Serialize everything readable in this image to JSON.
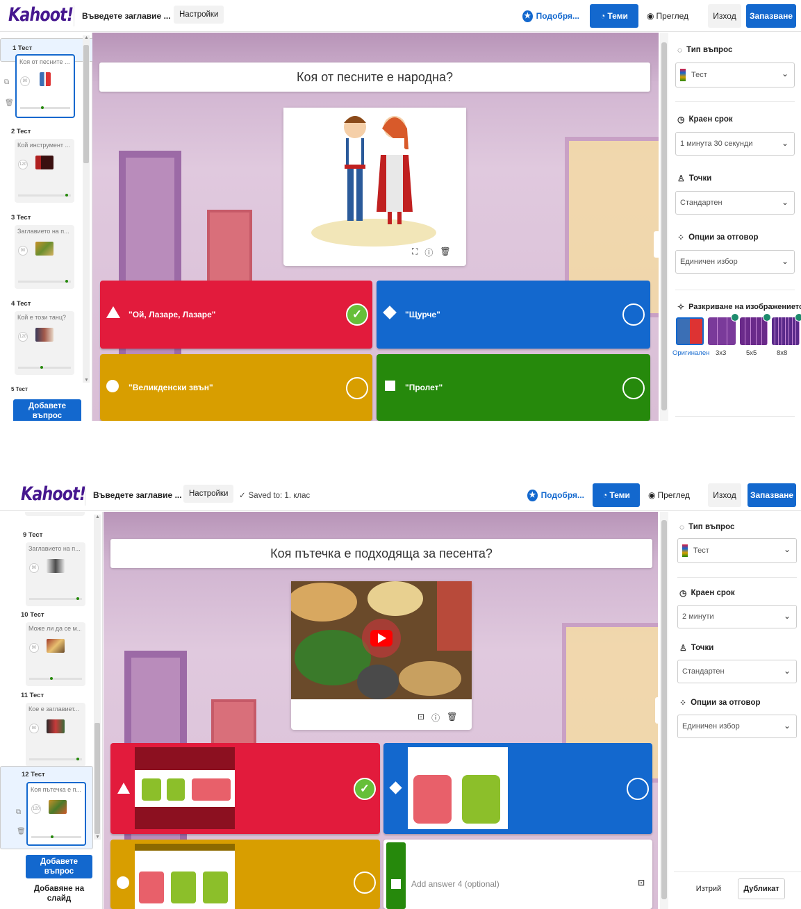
{
  "brand": {
    "logo": "Kahoot!"
  },
  "header": {
    "title_placeholder": "Въведете заглавие ...",
    "settings": "Настройки",
    "upgrade": "Подобря...",
    "themes": "Теми",
    "preview": "Преглед",
    "exit": "Изход",
    "save": "Запазване",
    "saved_status": "Saved to: 1. клас"
  },
  "sidebar": {
    "add_question": "Добавете въпрос",
    "add_slide": "Добавяне на слайд",
    "top_slides": [
      {
        "label": "1 Тест",
        "question": "Коя от песните ...",
        "time": "90"
      },
      {
        "label": "2 Тест",
        "question": "Кой инструмент ...",
        "time": "120"
      },
      {
        "label": "3 Тест",
        "question": "Заглавието на п...",
        "time": "90"
      },
      {
        "label": "4 Тест",
        "question": "Кой е този танц?",
        "time": "120"
      },
      {
        "label": "5 Тест",
        "question": "",
        "time": ""
      }
    ],
    "bottom_slides": [
      {
        "label": "9 Тест",
        "question": "Заглавието на п...",
        "time": "90"
      },
      {
        "label": "10 Тест",
        "question": "Може ли да се м...",
        "time": "90"
      },
      {
        "label": "11 Тест",
        "question": "Кое е заглавиет...",
        "time": "90"
      },
      {
        "label": "12 Тест",
        "question": "Коя пътечка е п...",
        "time": "120"
      }
    ]
  },
  "editor_top": {
    "question": "Коя от песните е народна?",
    "answers": [
      {
        "text": "\"Ой, Лазаре, Лазаре\"",
        "shape": "triangle",
        "color": "#e21b3c",
        "correct": true
      },
      {
        "text": "\"Щурче\"",
        "shape": "diamond",
        "color": "#1368ce",
        "correct": false
      },
      {
        "text": "\"Великденски звън\"",
        "shape": "circle",
        "color": "#d89e00",
        "correct": false
      },
      {
        "text": "\"Пролет\"",
        "shape": "square",
        "color": "#26890c",
        "correct": false
      }
    ]
  },
  "editor_bottom": {
    "question": "Коя пътечка е подходяща за песента?",
    "answer4_placeholder": "Add answer 4 (optional)"
  },
  "settings_panel": {
    "question_type_label": "Тип въпрос",
    "question_type_value": "Тест",
    "time_limit_label": "Краен срок",
    "time_limit_top": "1 минута 30 секунди",
    "time_limit_bottom": "2 минути",
    "points_label": "Точки",
    "points_value": "Стандартен",
    "answer_options_label": "Опции за отговор",
    "answer_options_value": "Единичен избор",
    "image_reveal_label": "Разкриване на изображението",
    "reveal_options": [
      "Оригинален",
      "3x3",
      "5x5",
      "8x8"
    ],
    "delete": "Изтрий",
    "duplicate": "Дубликат"
  },
  "colors": {
    "brand": "#46178f",
    "accent": "#1368ce",
    "red": "#e21b3c",
    "blue": "#1368ce",
    "yellow": "#d89e00",
    "green": "#26890c",
    "check": "#66bf39"
  }
}
